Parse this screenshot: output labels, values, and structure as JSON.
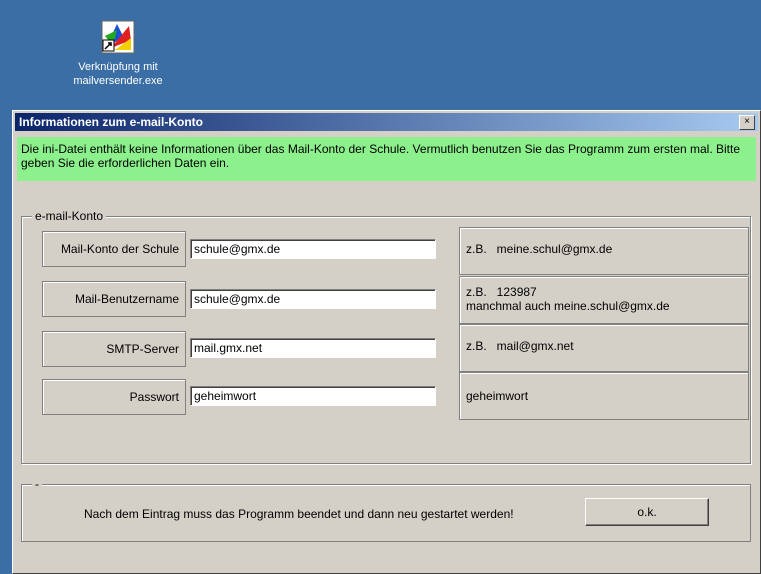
{
  "desktop": {
    "icon_name": "mailversender-shortcut-icon",
    "icon_label": "Verknüpfung mit mailversender.exe"
  },
  "dialog": {
    "title": "Informationen zum e-mail-Konto",
    "close_label": "×",
    "info_text": "Die ini-Datei enthält keine Informationen über das Mail-Konto der Schule. Vermutlich benutzen Sie das Programm zum ersten mal. Bitte geben Sie die erforderlichen Daten ein.",
    "group_title": "e-mail-Konto",
    "fields": [
      {
        "label": "Mail-Konto der Schule",
        "value": "schule@gmx.de"
      },
      {
        "label": "Mail-Benutzername",
        "value": "schule@gmx.de"
      },
      {
        "label": "SMTP-Server",
        "value": "mail.gmx.net"
      },
      {
        "label": "Passwort",
        "value": "geheimwort"
      }
    ],
    "examples": [
      {
        "line1": "z.B.   meine.schul@gmx.de",
        "line2": ""
      },
      {
        "line1": "z.B.   123987",
        "line2": "manchmal auch meine.schul@gmx.de"
      },
      {
        "line1": "z.B.   mail@gmx.net",
        "line2": ""
      },
      {
        "line1": "geheimwort",
        "line2": ""
      }
    ],
    "bottom_group_title": "-",
    "notice": "Nach dem Eintrag muss das Programm beendet und dann neu gestartet werden!",
    "ok_label": "o.k."
  },
  "colors": {
    "desktop": "#3a6ea5",
    "banner": "#8cf08c",
    "titlebar_start": "#0a246a"
  }
}
